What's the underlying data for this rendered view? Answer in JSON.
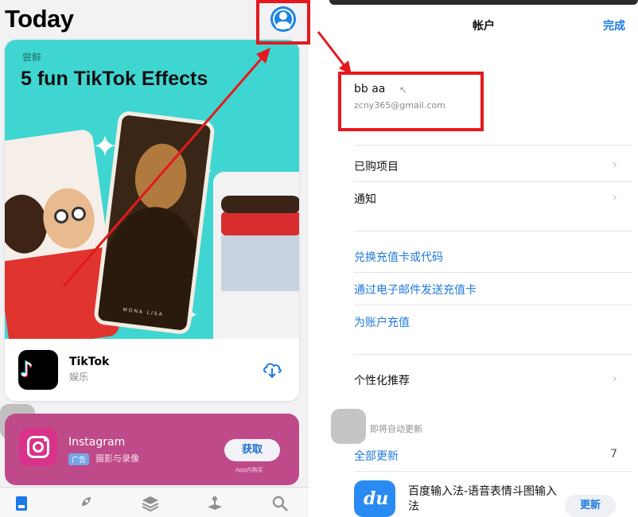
{
  "left": {
    "title": "Today",
    "card": {
      "subtitle": "尝鲜",
      "headline": "5 fun TikTok Effects",
      "app_name": "TikTok",
      "app_category": "娱乐",
      "painting_caption": "MONA LISA"
    },
    "card2": {
      "app_name": "Instagram",
      "ad_badge": "广告",
      "app_category": "摄影与录像",
      "get_label": "获取",
      "in_app_label": "App内购买"
    },
    "tabs": [
      "today-icon",
      "rocket-icon",
      "layers-icon",
      "arcade-icon",
      "search-icon"
    ]
  },
  "right": {
    "nav_title": "帐户",
    "done_label": "完成",
    "account_name": "bb aa",
    "account_email": "zcny365@gmail.com",
    "rows": [
      "已购项目",
      "通知"
    ],
    "links": [
      "兑换充值卡或代码",
      "通过电子邮件发送充值卡",
      "为账户充值"
    ],
    "personalized": "个性化推荐",
    "section_header": "即将自动更新",
    "update_all": "全部更新",
    "update_count": "7",
    "baidu_name": "百度输入法-语音表情斗图输入法",
    "baidu_icon_text": "du",
    "update_label": "更新"
  },
  "colors": {
    "accent_blue": "#1a7ae8",
    "annotation_red": "#e5191d",
    "card_teal": "#3fd6d2"
  }
}
